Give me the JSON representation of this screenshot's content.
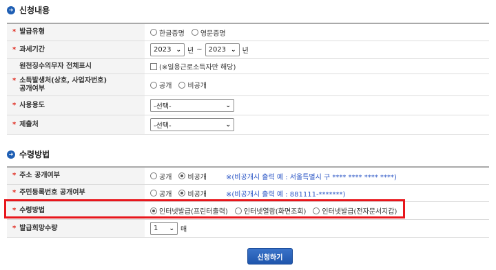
{
  "section1": {
    "title": "신청내용",
    "rows": {
      "issue_type": {
        "label": "발급유형",
        "options": [
          "한글증명",
          "영문증명"
        ]
      },
      "tax_period": {
        "label": "과세기간",
        "from": "2023",
        "to": "2023",
        "unit": "년",
        "sep": "~"
      },
      "withholding": {
        "label": "원천징수의무자 전체표시",
        "checkbox_text": "(※일용근로소득자만 해당)"
      },
      "income_source": {
        "label_line1": "소득발생처(상호, 사업자번호)",
        "label_line2": "공개여부",
        "options": [
          "공개",
          "비공개"
        ]
      },
      "purpose": {
        "label": "사용용도",
        "selected": "-선택-"
      },
      "submit_to": {
        "label": "제출처",
        "selected": "-선택-"
      }
    }
  },
  "section2": {
    "title": "수령방법",
    "rows": {
      "address": {
        "label": "주소 공개여부",
        "options": [
          "공개",
          "비공개"
        ],
        "note": "※(비공개시 출력 예 : 서울특별시      구 **** **** **** ****)"
      },
      "resident_no": {
        "label": "주민등록번호 공개여부",
        "options": [
          "공개",
          "비공개"
        ],
        "note": "※(비공개시 출력 예 : 881111-*******)"
      },
      "receive_method": {
        "label": "수령방법",
        "options": [
          "인터넷발급(프린터출력)",
          "인터넷열람(화면조회)",
          "인터넷발급(전자문서지갑)"
        ]
      },
      "copies": {
        "label": "발급희망수량",
        "selected": "1",
        "unit": "매"
      }
    }
  },
  "submit_label": "신청하기",
  "required_mark": "*",
  "colors": {
    "accent": "#1f5fb4",
    "required": "#e0261b",
    "highlight": "#e8161c",
    "note": "#2a55c5"
  }
}
